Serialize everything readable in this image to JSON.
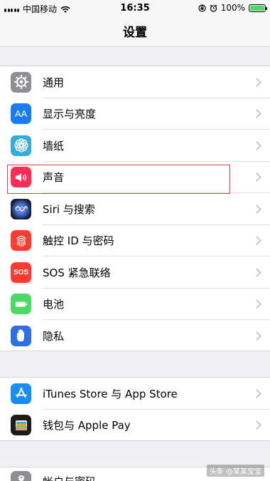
{
  "status": {
    "carrier": "中国移动",
    "time": "16:35",
    "battery": "100%",
    "battery_level": 1.0
  },
  "nav": {
    "title": "设置"
  },
  "group1": [
    {
      "label": "通用",
      "icon": "gear-icon",
      "color": "#8e8e93"
    },
    {
      "label": "显示与亮度",
      "icon": "display-brightness-icon",
      "color": "#1a7cf2"
    },
    {
      "label": "墙纸",
      "icon": "wallpaper-flower-icon",
      "color": "#35aadc"
    },
    {
      "label": "声音",
      "icon": "speaker-icon",
      "color": "#ff2d55"
    },
    {
      "label": "Siri 与搜索",
      "icon": "siri-icon",
      "color": "#1d1d3a"
    },
    {
      "label": "触控 ID 与密码",
      "icon": "fingerprint-icon",
      "color": "#ff3b30"
    },
    {
      "label": "SOS 紧急联络",
      "icon": "sos-icon",
      "color": "#ff3b30"
    },
    {
      "label": "电池",
      "icon": "battery-icon",
      "color": "#4cd964"
    },
    {
      "label": "隐私",
      "icon": "hand-icon",
      "color": "#2f6fe4"
    }
  ],
  "group2": [
    {
      "label": "iTunes Store 与 App Store",
      "icon": "app-store-icon",
      "color": "#1a8cf5"
    },
    {
      "label": "钱包与 Apple Pay",
      "icon": "wallet-icon",
      "color": "#1c1c1e"
    }
  ],
  "group3": [
    {
      "label": "帐户与密码",
      "icon": "key-icon",
      "color": "#8e8e93"
    }
  ],
  "icon_text": {
    "aa": "AA",
    "sos": "SOS"
  },
  "watermark": "头条 @某某宝宝"
}
